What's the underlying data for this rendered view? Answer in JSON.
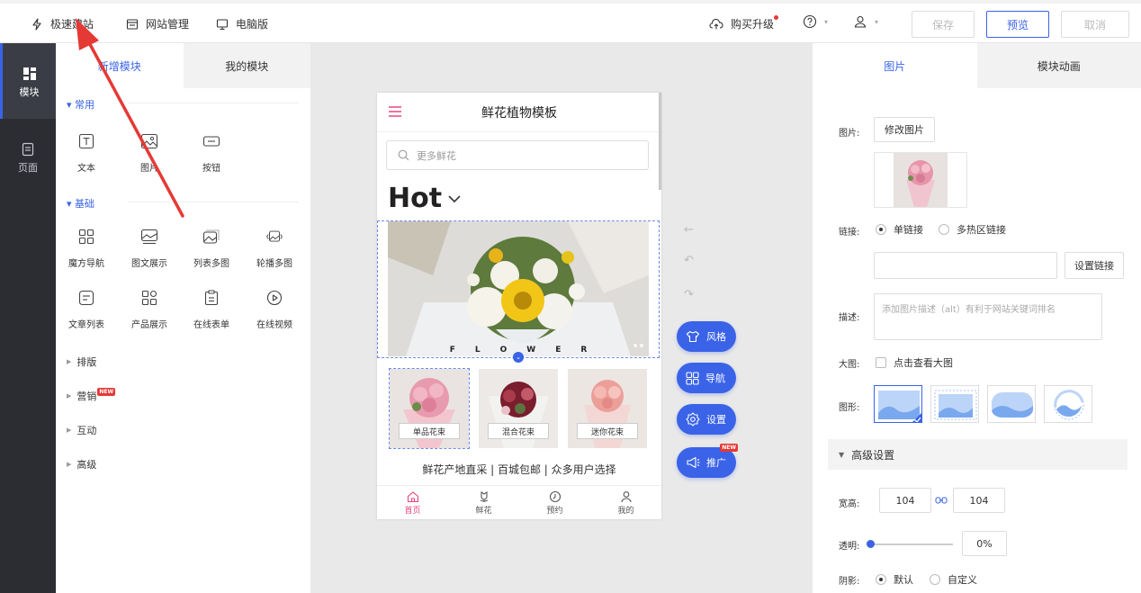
{
  "topbar": {
    "quick_build": "极速建站",
    "site_manage": "网站管理",
    "pc_version": "电脑版",
    "buy_upgrade": "购买升级",
    "save": "保存",
    "preview": "预览",
    "cancel": "取消"
  },
  "rail": {
    "items": [
      {
        "label": "模块",
        "icon": "grid-icon"
      },
      {
        "label": "页面",
        "icon": "page-icon"
      }
    ]
  },
  "modules": {
    "tabs": [
      "新增模块",
      "我的模块"
    ],
    "sections": {
      "common": {
        "title": "常用",
        "items": [
          "文本",
          "图片",
          "按钮"
        ]
      },
      "basic": {
        "title": "基础",
        "items": [
          "魔方导航",
          "图文展示",
          "列表多图",
          "轮播多图",
          "文章列表",
          "产品展示",
          "在线表单",
          "在线视频"
        ]
      }
    },
    "collapsed": [
      "排版",
      "营销",
      "互动",
      "高级"
    ],
    "new_badge": "NEW"
  },
  "phone": {
    "title": "鲜花植物模板",
    "search_placeholder": "更多鲜花",
    "hot": "Hot",
    "banner_letters": [
      "F",
      "L",
      "O",
      "W",
      "E",
      "R"
    ],
    "products": [
      "单品花束",
      "混合花束",
      "迷你花束"
    ],
    "slogan": "鲜花产地直采 | 百城包邮 | 众多用户选择",
    "nav": [
      "首页",
      "鲜花",
      "预约",
      "我的"
    ]
  },
  "float_buttons": [
    "风格",
    "导航",
    "设置",
    "推广"
  ],
  "props": {
    "tabs": [
      "图片",
      "模块动画"
    ],
    "image_label": "图片:",
    "modify_image": "修改图片",
    "link_label": "链接:",
    "link_single": "单链接",
    "link_multi": "多热区链接",
    "set_link": "设置链接",
    "desc_label": "描述:",
    "desc_placeholder": "添加图片描述（alt）有利于网站关键词排名",
    "bigimg_label": "大图:",
    "bigimg_check": "点击查看大图",
    "shape_label": "图形:",
    "advanced": "高级设置",
    "size_label": "宽高:",
    "width": "104",
    "height": "104",
    "opacity_label": "透明:",
    "opacity": "0%",
    "opacity_fraction": 0,
    "shadow_label": "阴影:",
    "shadow_default": "默认",
    "shadow_custom": "自定义"
  },
  "colors": {
    "accent": "#3a63e8",
    "rail_bg": "#2b2d33",
    "pink": "#e8457b",
    "arrow": "#e53935"
  }
}
